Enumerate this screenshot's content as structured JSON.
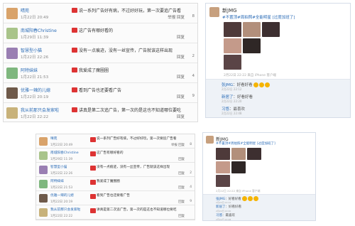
{
  "comment_rows": [
    {
      "name": "晴苑",
      "text": "说一系列广告好有病，不过好好玩，第一次要追广告看",
      "date": "1月22日 20:49",
      "actions": "举报 回复",
      "likes": "8",
      "av": "#d9a36a"
    },
    {
      "name": "南城阳春Christine",
      "text": "这广告有哪好看的",
      "date": "1月29日 11:39",
      "actions": "回复",
      "likes": "",
      "av": "#a9c48a"
    },
    {
      "name": "智慧型小猫",
      "text": "没有一点痕迹，没有一丝宣传，广告就该这样出现",
      "date": "1月22日 22:26",
      "actions": "回复",
      "likes": "2",
      "av": "#9a7fb3"
    },
    {
      "name": "阿特妹妹",
      "text": "我爱成了魔圈圈",
      "date": "1月22日 21:53",
      "actions": "回复",
      "likes": "4",
      "av": "#7fb77e"
    },
    {
      "name": "优雅一辣的儿媳",
      "text": "看到广告也还要看广告",
      "date": "1月22日 20:19",
      "actions": "回复",
      "likes": "9",
      "av": "#6f5a4a"
    },
    {
      "name": "我从前那只会发家啦",
      "text": "讲真是第二次追广告，第一次的是这也不知道哪位要吃",
      "date": "1月22日 22:22",
      "actions": "回复",
      "likes": "",
      "av": "#c8b27a"
    }
  ],
  "weibo": {
    "name": "新JMG",
    "text": "#不置顶#周拍照#全能明星 [过度加班了]",
    "meta": "2月22日 22:22 来自 iPhone 客户端",
    "comments": [
      {
        "name": "张JMG",
        "text": "好看好看",
        "emoji": 3
      },
      {
        "name": "新居了",
        "text": "好看好看",
        "emoji": 0
      },
      {
        "name": "习悠",
        "text": "最喜欢",
        "emoji": 0
      }
    ],
    "comment_dates": [
      "2月22日 22:12",
      "2月22日 22:20",
      "2月22日 22:48"
    ]
  }
}
